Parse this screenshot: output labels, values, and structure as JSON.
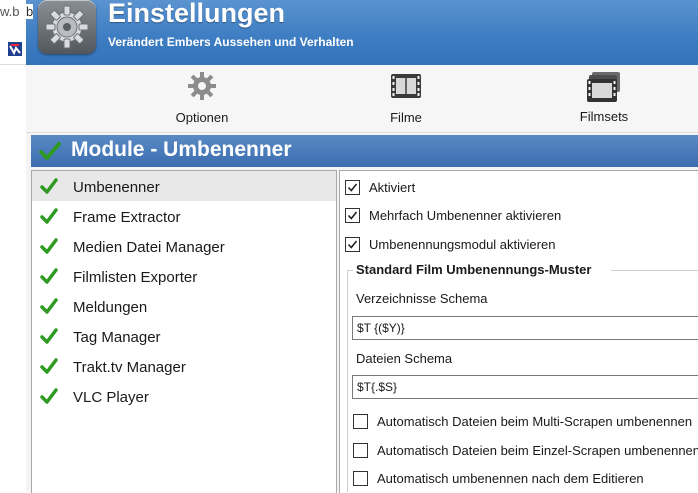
{
  "background": {
    "url_fragment": "w.b",
    "url_tail": "b"
  },
  "header": {
    "title": "Einstellungen",
    "subtitle": "Verändert Embers Aussehen und Verhalten",
    "icon": "gear-app-icon"
  },
  "toolbar": {
    "items": [
      {
        "label": "Optionen",
        "icon": "gear-icon"
      },
      {
        "label": "Filme",
        "icon": "film-icon"
      },
      {
        "label": "Filmsets",
        "icon": "filmsets-icon"
      }
    ]
  },
  "section": {
    "title": "Module - Umbenenner",
    "icon": "checkmark-icon"
  },
  "modules": {
    "selected": "Umbenenner",
    "items": [
      {
        "label": "Umbenenner"
      },
      {
        "label": "Frame Extractor"
      },
      {
        "label": "Medien Datei Manager"
      },
      {
        "label": "Filmlisten Exporter"
      },
      {
        "label": "Meldungen"
      },
      {
        "label": "Tag Manager"
      },
      {
        "label": "Trakt.tv Manager"
      },
      {
        "label": "VLC Player"
      }
    ]
  },
  "settings": {
    "checkboxes": [
      {
        "label": "Aktiviert",
        "checked": true
      },
      {
        "label": "Mehrfach Umbenenner aktivieren",
        "checked": true
      },
      {
        "label": "Umbenennungsmodul aktivieren",
        "checked": true
      }
    ],
    "group_title": "Standard Film Umbenennungs-Muster",
    "folder_schema_label": "Verzeichnisse Schema",
    "folder_schema_value": "$T {($Y)}",
    "file_schema_label": "Dateien Schema",
    "file_schema_value": "$T{.$S}",
    "auto_options": [
      {
        "label": "Automatisch Dateien beim Multi-Scrapen umbenennen",
        "checked": false
      },
      {
        "label": "Automatisch Dateien beim Einzel-Scrapen umbenennen",
        "checked": false
      },
      {
        "label": "Automatisch umbenennen nach dem Editieren",
        "checked": false
      }
    ]
  },
  "colors": {
    "header_blue": "#3f7ec3",
    "section_blue": "#3b6db0",
    "check_green": "#2e9a22"
  }
}
